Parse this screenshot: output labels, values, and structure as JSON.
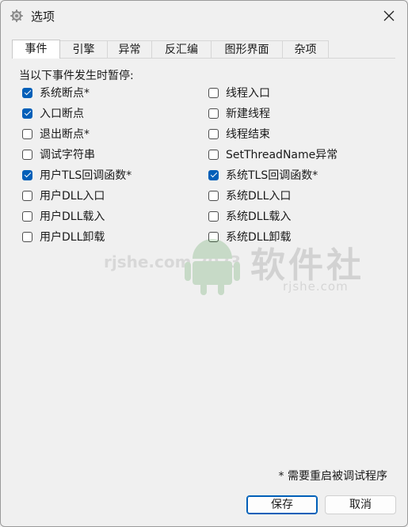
{
  "window": {
    "title": "选项",
    "icon": "gear-icon"
  },
  "tabs": [
    {
      "label": "事件",
      "active": true
    },
    {
      "label": "引擎",
      "active": false
    },
    {
      "label": "异常",
      "active": false
    },
    {
      "label": "反汇编",
      "active": false
    },
    {
      "label": "图形界面",
      "active": false
    },
    {
      "label": "杂项",
      "active": false
    }
  ],
  "events": {
    "section_label": "当以下事件发生时暂停:",
    "left": [
      {
        "label": "系统断点*",
        "checked": true
      },
      {
        "label": "入口断点",
        "checked": true
      },
      {
        "label": "退出断点*",
        "checked": false
      },
      {
        "label": "调试字符串",
        "checked": false
      },
      {
        "label": "用户TLS回调函数*",
        "checked": true
      },
      {
        "label": "用户DLL入口",
        "checked": false
      },
      {
        "label": "用户DLL载入",
        "checked": false
      },
      {
        "label": "用户DLL卸载",
        "checked": false
      }
    ],
    "right": [
      {
        "label": "线程入口",
        "checked": false
      },
      {
        "label": "新建线程",
        "checked": false
      },
      {
        "label": "线程结束",
        "checked": false
      },
      {
        "label": "SetThreadName异常",
        "checked": false
      },
      {
        "label": "系统TLS回调函数*",
        "checked": true
      },
      {
        "label": "系统DLL入口",
        "checked": false
      },
      {
        "label": "系统DLL载入",
        "checked": false
      },
      {
        "label": "系统DLL卸载",
        "checked": false
      }
    ]
  },
  "footnote": "* 需要重启被调试程序",
  "buttons": {
    "save": "保存",
    "cancel": "取消"
  },
  "watermark": {
    "small": "rjshe.com 2023",
    "big": "软件社",
    "url": "rjshe.com"
  },
  "colors": {
    "accent": "#005fb8",
    "background": "#f0f0f0"
  }
}
